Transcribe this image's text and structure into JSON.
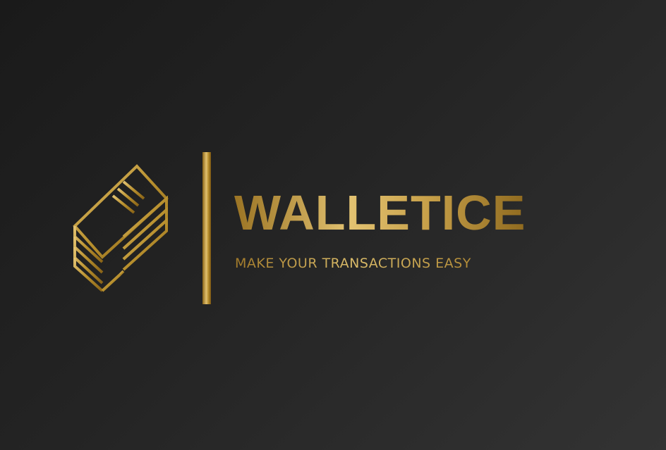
{
  "brand": {
    "name": "WALLETICE",
    "tagline": "MAKE YOUR TRANSACTIONS EASY",
    "icon": "money-stack-icon",
    "colors": {
      "background": "#1e1e1e",
      "gold_light": "#e2c271",
      "gold_mid": "#c9a24b",
      "gold_dark": "#8f6a1f"
    }
  }
}
